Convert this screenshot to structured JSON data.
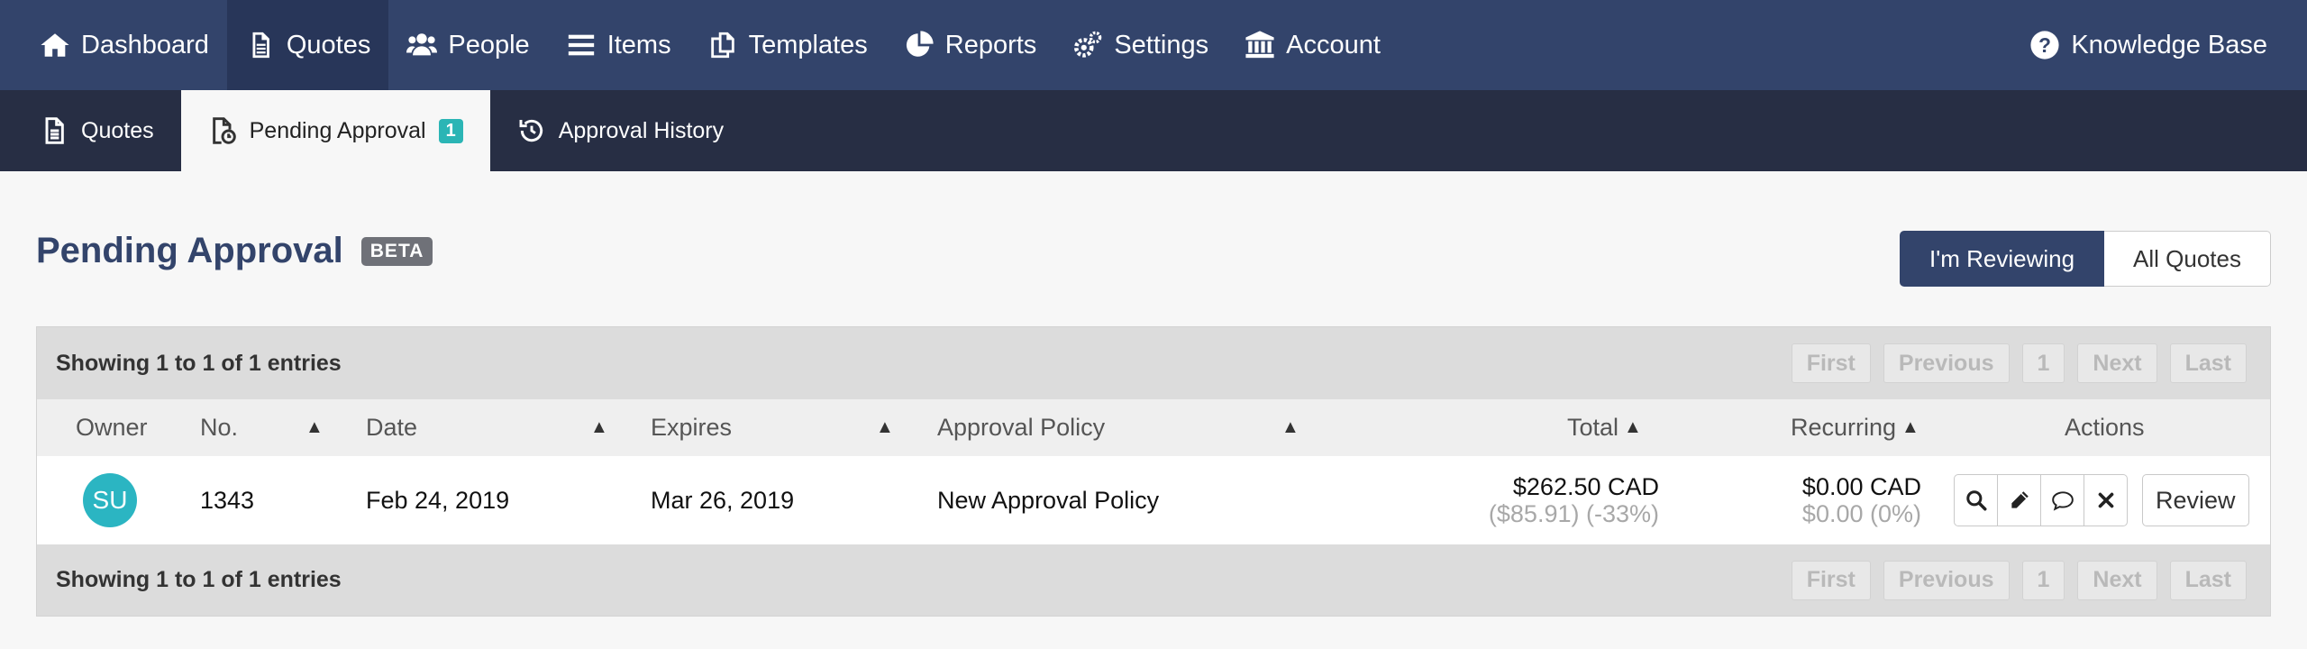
{
  "topnav": {
    "items": [
      {
        "label": "Dashboard",
        "icon": "home-icon"
      },
      {
        "label": "Quotes",
        "icon": "document-icon"
      },
      {
        "label": "People",
        "icon": "users-icon"
      },
      {
        "label": "Items",
        "icon": "list-icon"
      },
      {
        "label": "Templates",
        "icon": "copy-icon"
      },
      {
        "label": "Reports",
        "icon": "pie-chart-icon"
      },
      {
        "label": "Settings",
        "icon": "gears-icon"
      },
      {
        "label": "Account",
        "icon": "bank-icon"
      }
    ],
    "knowledge_base": "Knowledge Base"
  },
  "subnav": {
    "quotes": "Quotes",
    "pending": "Pending Approval",
    "pending_count": "1",
    "history": "Approval History"
  },
  "page": {
    "title": "Pending Approval",
    "beta": "BETA",
    "toggle_reviewing": "I'm Reviewing",
    "toggle_all": "All Quotes"
  },
  "table": {
    "info_top": "Showing 1 to 1 of 1 entries",
    "info_bottom": "Showing 1 to 1 of 1 entries",
    "pager": {
      "first": "First",
      "previous": "Previous",
      "page": "1",
      "next": "Next",
      "last": "Last"
    },
    "columns": {
      "owner": "Owner",
      "no": "No.",
      "date": "Date",
      "expires": "Expires",
      "policy": "Approval Policy",
      "total": "Total",
      "recurring": "Recurring",
      "actions": "Actions"
    },
    "rows": [
      {
        "owner_initials": "SU",
        "no": "1343",
        "date": "Feb 24, 2019",
        "expires": "Mar 26, 2019",
        "policy": "New Approval Policy",
        "total": "$262.50 CAD",
        "total_sub": "($85.91) (-33%)",
        "recurring": "$0.00 CAD",
        "recurring_sub": "$0.00 (0%)",
        "review_label": "Review"
      }
    ]
  },
  "colors": {
    "nav": "#33446b",
    "subnav": "#272e44",
    "accent": "#2bb5b5"
  }
}
